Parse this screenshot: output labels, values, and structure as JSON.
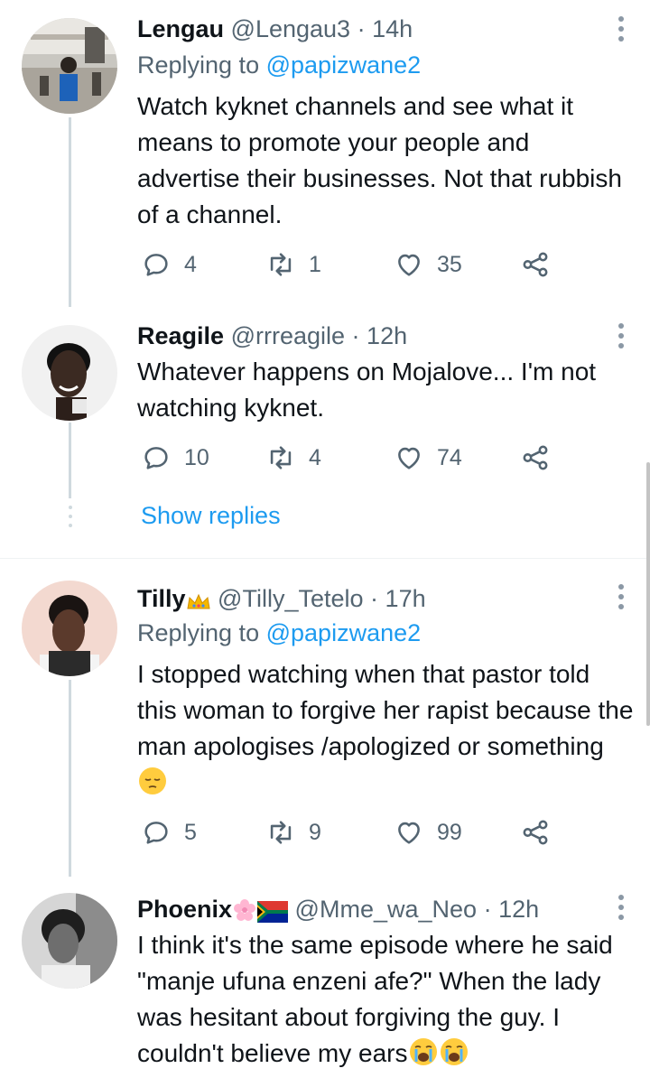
{
  "tweets": [
    {
      "name": "Lengau",
      "handle": "@Lengau3",
      "time": "14h",
      "replying_label": "Replying to",
      "replying_handle": "@papizwane2",
      "text": "Watch kyknet channels and see what it means to promote your people and advertise their businesses. Not that rubbish of a channel.",
      "replies": "4",
      "retweets": "1",
      "likes": "35"
    },
    {
      "name": "Reagile",
      "handle": "@rrreagile",
      "time": "12h",
      "text": "Whatever happens on Mojalove... I'm not watching kyknet.",
      "replies": "10",
      "retweets": "4",
      "likes": "74",
      "show_replies": "Show replies"
    },
    {
      "name": "Tilly",
      "handle": "@Tilly_Tetelo",
      "time": "17h",
      "replying_label": "Replying to",
      "replying_handle": "@papizwane2",
      "text": "I stopped watching when that pastor told this woman to forgive her rapist because the man apologises /apologized or something",
      "replies": "5",
      "retweets": "9",
      "likes": "99"
    },
    {
      "name": "Phoenix",
      "handle": "@Mme_wa_Neo",
      "time": "12h",
      "text": "I think it's the same episode where he said \"manje ufuna enzeni afe?\" When the lady was hesitant about forgiving the guy. I couldn't believe my ears"
    }
  ],
  "separator": "·",
  "icons": [
    "reply-icon",
    "retweet-icon",
    "like-icon",
    "share-icon",
    "more-icon",
    "crown-emoji",
    "pensive-emoji",
    "blossom-emoji",
    "south-africa-flag-emoji",
    "crying-emoji"
  ],
  "colors": {
    "link": "#1d9bf0",
    "muted": "#536471",
    "text": "#0f1419",
    "thread": "#cfd9de"
  }
}
